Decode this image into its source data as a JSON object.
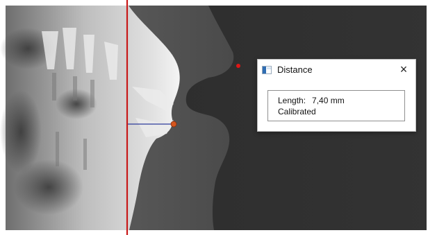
{
  "dialog": {
    "title": "Distance",
    "close_glyph": "×",
    "app_icon": "app-window-icon",
    "measurement": {
      "length_label": "Length:",
      "length_value": "7,40 mm",
      "status": "Calibrated"
    }
  },
  "colors": {
    "reference_line": "#c81818",
    "measure_line": "#2c3a9a",
    "endpoint": "#d4561e",
    "marker_dot": "#e01515",
    "background": "#303030"
  }
}
